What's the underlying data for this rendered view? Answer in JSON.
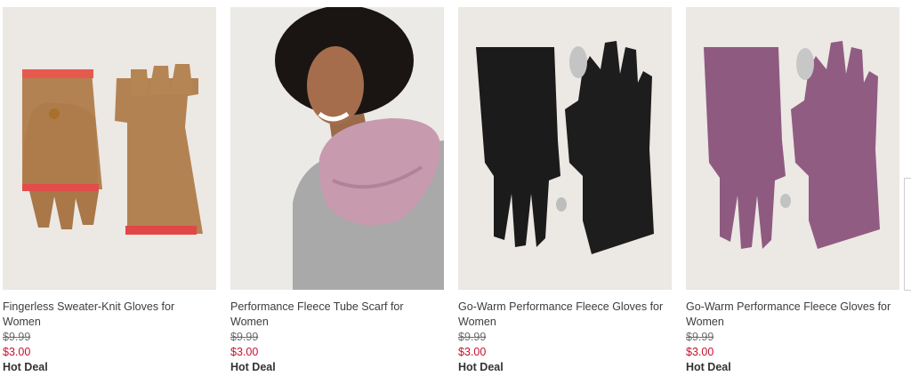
{
  "products": [
    {
      "title": "Fingerless Sweater-Knit Gloves for Women",
      "original_price": "$9.99",
      "sale_price": "$3.00",
      "badge": "Hot Deal",
      "image": "fingerless-knit-gloves-photo"
    },
    {
      "title": "Performance Fleece Tube Scarf for Women",
      "original_price": "$9.99",
      "sale_price": "$3.00",
      "badge": "Hot Deal",
      "image": "woman-wearing-tube-scarf-photo"
    },
    {
      "title": "Go-Warm Performance Fleece Gloves for Women",
      "original_price": "$9.99",
      "sale_price": "$3.00",
      "badge": "Hot Deal",
      "image": "black-fleece-gloves-photo"
    },
    {
      "title": "Go-Warm Performance Fleece Gloves for Women",
      "original_price": "$9.99",
      "sale_price": "$3.00",
      "badge": "Hot Deal",
      "image": "purple-fleece-gloves-photo"
    }
  ],
  "colors": {
    "sale_price": "#c8102e",
    "background": "#ebe6e0"
  },
  "carousel": {
    "next_icon": "carousel-next-arrow-icon"
  }
}
